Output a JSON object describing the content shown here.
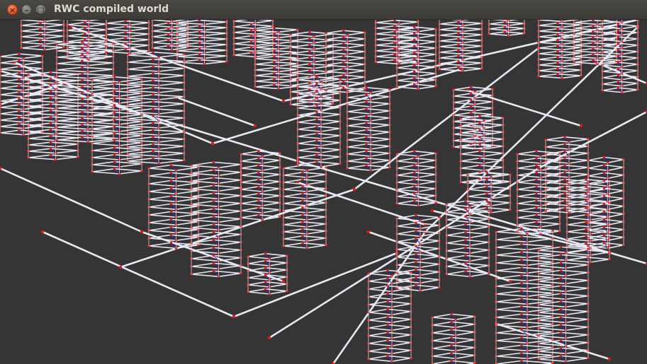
{
  "window": {
    "title": "RWC compiled world",
    "buttons": {
      "close": "×",
      "minimize": "–",
      "maximize": "□"
    }
  },
  "scene": {
    "background": "#353535",
    "road_color": "#e8e8f4",
    "node_color": "#e21a1a",
    "inner_edge_color": "#2a2ae0"
  }
}
